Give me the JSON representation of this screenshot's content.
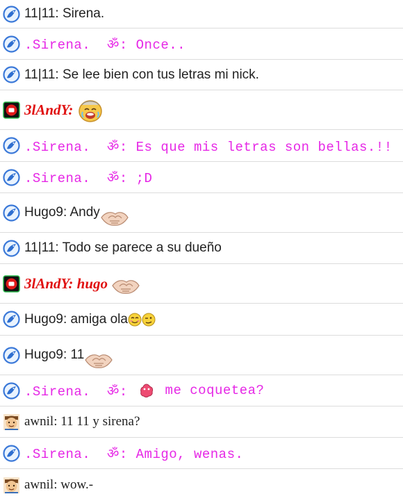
{
  "messages": [
    {
      "user": "11|11",
      "style": "sans",
      "avatar": "dolphin-icon",
      "text": "11|11: Sirena."
    },
    {
      "user": ".Sirena.",
      "style": "mono",
      "avatar": "dolphin-icon",
      "text": ".Sirena.  ॐ: Once.."
    },
    {
      "user": "11|11",
      "style": "sans",
      "avatar": "dolphin-icon",
      "text": "11|11: Se lee bien con tus letras mi nick."
    },
    {
      "user": "3lAndY",
      "style": "red",
      "avatar": "red-square-icon",
      "text": "3lAndY:",
      "emoji": "crying-laughing-emoji"
    },
    {
      "user": ".Sirena.",
      "style": "mono",
      "avatar": "dolphin-icon",
      "text": ".Sirena.  ॐ: Es que mis letras son bellas.!!"
    },
    {
      "user": ".Sirena.",
      "style": "mono",
      "avatar": "dolphin-icon",
      "text": ".Sirena.  ॐ: ;D"
    },
    {
      "user": "Hugo9",
      "style": "sans",
      "avatar": "dolphin-icon",
      "text": "Hugo9: Andy",
      "emoji": "handshake-emoji"
    },
    {
      "user": "11|11",
      "style": "sans",
      "avatar": "dolphin-icon",
      "text": "11|11: Todo se parece a su dueño"
    },
    {
      "user": "3lAndY",
      "style": "red",
      "avatar": "red-square-icon",
      "text": "3lAndY: hugo",
      "emoji": "handshake-emoji"
    },
    {
      "user": "Hugo9",
      "style": "sans",
      "avatar": "dolphin-icon",
      "text": "Hugo9: amiga ola",
      "emoji": "blushing-and-winking-emoji"
    },
    {
      "user": "Hugo9",
      "style": "sans",
      "avatar": "dolphin-icon",
      "text": "Hugo9: 11",
      "emoji": "handshake-emoji"
    },
    {
      "user": ".Sirena.",
      "style": "mono",
      "avatar": "dolphin-icon",
      "text_before": ".Sirena.  ॐ: ",
      "emoji": "pink-blob-emoji",
      "text_after": " me coquetea?"
    },
    {
      "user": "awnil",
      "style": "serif",
      "avatar": "face-avatar-icon",
      "text": "awnil: 11 11 y sirena?"
    },
    {
      "user": ".Sirena.",
      "style": "mono",
      "avatar": "dolphin-icon",
      "text": ".Sirena.  ॐ: Amigo, wenas."
    },
    {
      "user": "awnil",
      "style": "serif",
      "avatar": "face-avatar-icon",
      "text": "awnil: wow.-"
    }
  ]
}
